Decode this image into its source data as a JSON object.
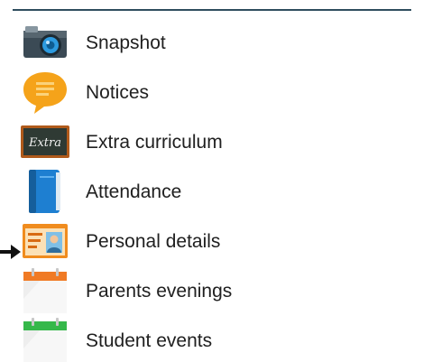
{
  "menu": {
    "items": [
      {
        "label": "Snapshot",
        "icon": "camera-icon"
      },
      {
        "label": "Notices",
        "icon": "speech-bubble-icon"
      },
      {
        "label": "Extra curriculum",
        "icon": "chalkboard-icon",
        "icon_text": "Extra"
      },
      {
        "label": "Attendance",
        "icon": "register-book-icon"
      },
      {
        "label": "Personal details",
        "icon": "id-card-icon"
      },
      {
        "label": "Parents evenings",
        "icon": "calendar-orange-icon"
      },
      {
        "label": "Student events",
        "icon": "calendar-green-icon"
      }
    ]
  },
  "colors": {
    "divider": "#2f4d5e",
    "text": "#202020",
    "notice_orange": "#f5a31a",
    "camera_blue": "#2d9be0",
    "chalkboard_frame": "#b05a1b",
    "book_blue": "#1e7fd1",
    "idcard_orange": "#f08c1e",
    "calendar_orange": "#f07a24",
    "calendar_green": "#35b84a"
  }
}
